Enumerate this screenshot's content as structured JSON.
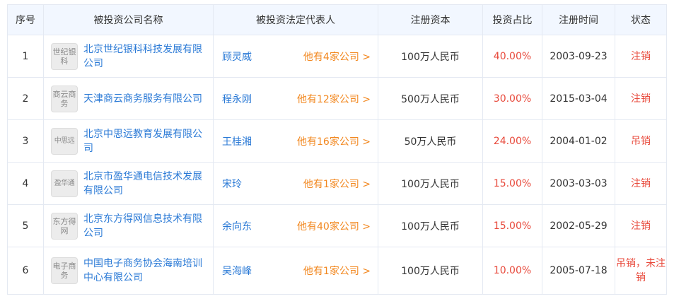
{
  "table": {
    "headers": [
      "序号",
      "被投资公司名称",
      "被投资法定代表人",
      "注册资本",
      "投资占比",
      "注册时间",
      "状态"
    ],
    "rows": [
      {
        "index": "1",
        "logo": "世纪银科",
        "company": "北京世纪银科科技发展有限公司",
        "rep": "顾灵威",
        "rep_more": "他有4家公司 >",
        "capital": "100万人民币",
        "ratio": "40.00%",
        "date": "2003-09-23",
        "status": "注销"
      },
      {
        "index": "2",
        "logo": "商云商务",
        "company": "天津商云商务服务有限公司",
        "rep": "程永刚",
        "rep_more": "他有12家公司 >",
        "capital": "500万人民币",
        "ratio": "30.00%",
        "date": "2015-03-04",
        "status": "注销"
      },
      {
        "index": "3",
        "logo": "中思远",
        "company": "北京中思远教育发展有限公司",
        "rep": "王桂湘",
        "rep_more": "他有16家公司 >",
        "capital": "50万人民币",
        "ratio": "24.00%",
        "date": "2004-01-02",
        "status": "吊销"
      },
      {
        "index": "4",
        "logo": "盈华通",
        "company": "北京市盈华通电信技术发展有限公司",
        "rep": "宋玲",
        "rep_more": "他有1家公司 >",
        "capital": "100万人民币",
        "ratio": "15.00%",
        "date": "2003-03-03",
        "status": "注销"
      },
      {
        "index": "5",
        "logo": "东方得网",
        "company": "北京东方得网信息技术有限公司",
        "rep": "余向东",
        "rep_more": "他有40家公司 >",
        "capital": "100万人民币",
        "ratio": "15.00%",
        "date": "2002-05-29",
        "status": "注销"
      },
      {
        "index": "6",
        "logo": "电子商务",
        "company": "中国电子商务协会海南培训中心有限公司",
        "rep": "吴海峰",
        "rep_more": "他有1家公司 >",
        "capital": "100万人民币",
        "ratio": "10.00%",
        "date": "2005-07-18",
        "status": "吊销，未注销"
      }
    ]
  }
}
